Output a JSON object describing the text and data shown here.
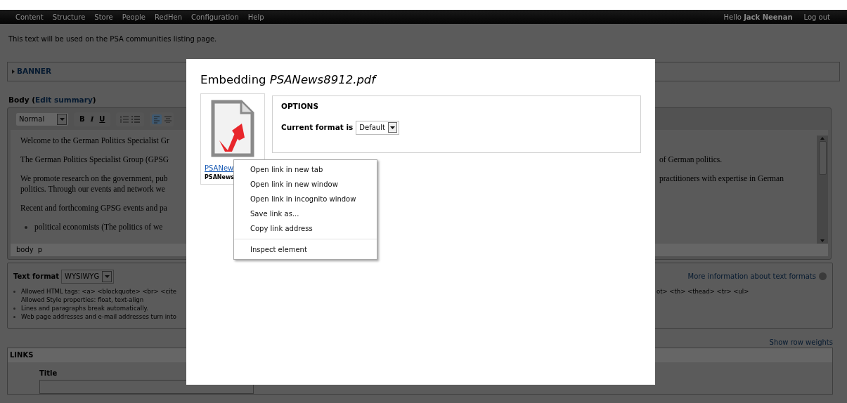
{
  "nav": {
    "items": [
      "Content",
      "Structure",
      "Store",
      "People",
      "RedHen",
      "Configuration",
      "Help"
    ],
    "greeting": "Hello **Jack Neenan**",
    "logout": "Log out"
  },
  "description": "This text will be used on the PSA communities listing page.",
  "banner": {
    "label": "BANNER",
    "expanded": false
  },
  "body": {
    "label_before": "Body (",
    "link": "Edit summary",
    "label_after": ")",
    "toolbar": {
      "style": "Normal",
      "format_buttons": [
        "B",
        "I",
        "U"
      ]
    },
    "blocks": [
      {
        "kind": "paragraph",
        "lines": [
          {
            "left": "Welcome to the German Politics Specialist Gr"
          }
        ]
      },
      {
        "kind": "paragraph",
        "lines": [
          {
            "left": "The German Politics Specialist Group (GPSG",
            "right": "of German politics."
          }
        ]
      },
      {
        "kind": "paragraph",
        "lines": [
          {
            "left": "We promote research on the government, pub",
            "right": "practitioners with expertise in German"
          },
          {
            "left": "politics. Through our events and network we"
          }
        ]
      },
      {
        "kind": "paragraph",
        "lines": [
          {
            "left": "Recent and forthcoming GPSG events and pa"
          }
        ]
      },
      {
        "kind": "bullet",
        "lines": [
          {
            "left": "political economists (The politics of we"
          }
        ]
      }
    ],
    "path": [
      "body",
      "p"
    ]
  },
  "text_format": {
    "label": "Text format",
    "value": "WYSIWYG",
    "more_link": "More information about text formats",
    "tips": [
      {
        "lines": [
          {
            "left": "Allowed HTML tags: <a> <blockquote> <br> <cite",
            "right": "ot> <th> <thead> <tr> <ul>"
          },
          {
            "left": "Allowed Style properties: float, text-align"
          }
        ]
      },
      {
        "lines": [
          {
            "left": "Lines and paragraphs break automatically."
          }
        ]
      },
      {
        "lines": [
          {
            "left": "Web page addresses and e-mail addresses turn into"
          }
        ]
      }
    ]
  },
  "show_row_weights": "Show row weights",
  "links": {
    "label": "LINKS",
    "field_label": "Title"
  },
  "modal": {
    "title": "Embedding *PSANews8912.pdf*",
    "file_link": "PSANew",
    "file_name": "PSANews",
    "options_title": "OPTIONS",
    "format_label": "Current format is",
    "format_value": "Default"
  },
  "context_menu": [
    {
      "kind": "item",
      "label": "Open link in new tab"
    },
    {
      "kind": "item",
      "label": "Open link in new window"
    },
    {
      "kind": "item",
      "label": "Open link in incognito window"
    },
    {
      "kind": "item",
      "label": "Save link as..."
    },
    {
      "kind": "item",
      "label": "Copy link address"
    },
    {
      "kind": "separator"
    },
    {
      "kind": "item",
      "label": "Inspect element"
    }
  ]
}
